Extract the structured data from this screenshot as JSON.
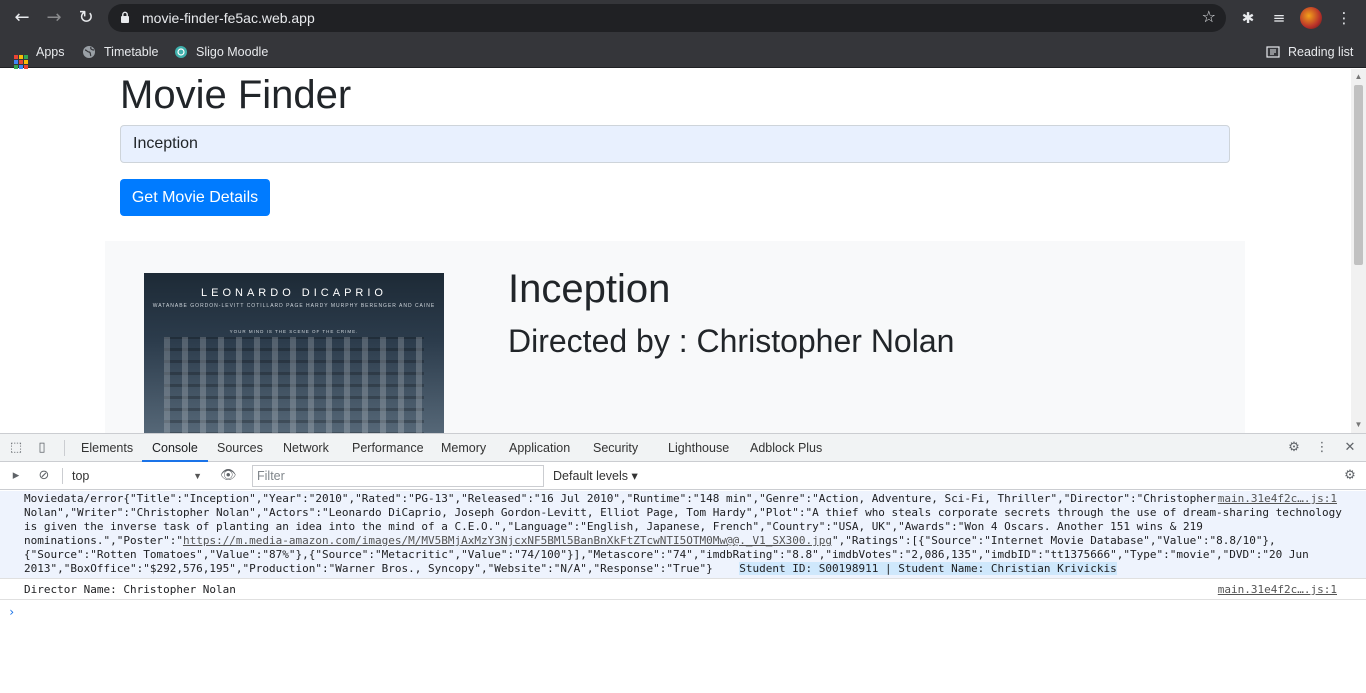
{
  "browser": {
    "url": "movie-finder-fe5ac.web.app",
    "bookmarks": [
      {
        "label": "Apps",
        "icon": "apps-grid-icon"
      },
      {
        "label": "Timetable",
        "icon": "globe-icon"
      },
      {
        "label": "Sligo Moodle",
        "icon": "moodle-icon"
      }
    ],
    "reading_list": "Reading list"
  },
  "page": {
    "title": "Movie Finder",
    "search_value": "Inception",
    "button_label": "Get Movie Details",
    "movie": {
      "title": "Inception",
      "director_line": "Directed by : Christopher Nolan",
      "poster": {
        "actor": "LEONARDO DICAPRIO",
        "cast": "WATANABE  GORDON-LEVITT  COTILLARD  PAGE  HARDY  MURPHY  BERENGER  AND  CAINE",
        "tagline": "YOUR MIND IS THE SCENE OF THE CRIME."
      }
    }
  },
  "devtools": {
    "tabs": [
      "Elements",
      "Console",
      "Sources",
      "Network",
      "Performance",
      "Memory",
      "Application",
      "Security",
      "Lighthouse",
      "Adblock Plus"
    ],
    "active_tab": "Console",
    "context": "top",
    "filter_placeholder": "Filter",
    "levels": "Default levels ▾",
    "logs": [
      {
        "lines": [
          "Moviedata/error{\"Title\":\"Inception\",\"Year\":\"2010\",\"Rated\":\"PG-13\",\"Released\":\"16 Jul 2010\",\"Runtime\":\"148 min\",\"Genre\":\"Action, Adventure, Sci-Fi, Thriller\",\"Director\":\"Christopher",
          "Nolan\",\"Writer\":\"Christopher Nolan\",\"Actors\":\"Leonardo DiCaprio, Joseph Gordon-Levitt, Elliot Page, Tom Hardy\",\"Plot\":\"A thief who steals corporate secrets through the use of dream-sharing technology",
          "is given the inverse task of planting an idea into the mind of a C.E.O.\",\"Language\":\"English, Japanese, French\",\"Country\":\"USA, UK\",\"Awards\":\"Won 4 Oscars. Another 151 wins & 219",
          "nominations.\",\"Poster\":\"",
          "https://m.media-amazon.com/images/M/MV5BMjAxMzY3NjcxNF5BMl5BanBnXkFtZTcwNTI5OTM0Mw@@._V1_SX300.jpg",
          "\",\"Ratings\":[{\"Source\":\"Internet Movie Database\",\"Value\":\"8.8/10\"},",
          "{\"Source\":\"Rotten Tomatoes\",\"Value\":\"87%\"},{\"Source\":\"Metacritic\",\"Value\":\"74/100\"}],\"Metascore\":\"74\",\"imdbRating\":\"8.8\",\"imdbVotes\":\"2,086,135\",\"imdbID\":\"tt1375666\",\"Type\":\"movie\",\"DVD\":\"20 Jun",
          "2013\",\"BoxOffice\":\"$292,576,195\",\"Production\":\"Warner Bros., Syncopy\",\"Website\":\"N/A\",\"Response\":\"True\"}    ",
          "Student ID: S00198911 | Student Name: Christian Krivickis"
        ],
        "source": "main.31e4f2c….js:1"
      },
      {
        "text": "Director Name: Christopher Nolan",
        "source": "main.31e4f2c….js:1"
      }
    ],
    "prompt": "›"
  }
}
